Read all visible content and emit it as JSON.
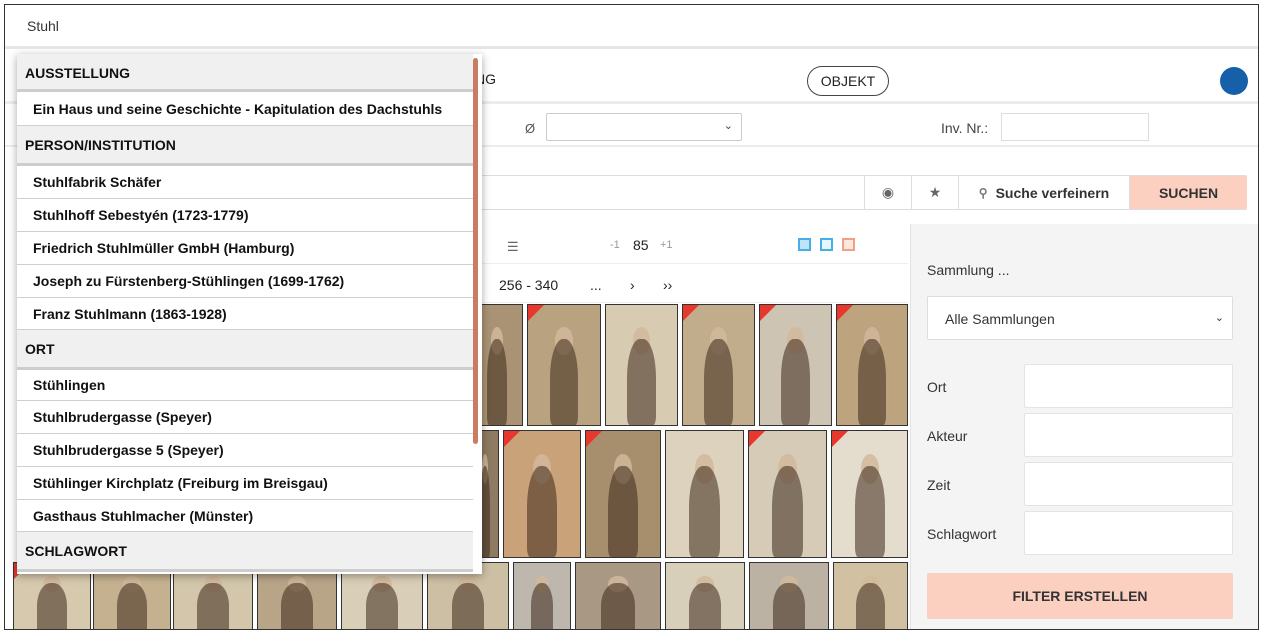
{
  "search": {
    "query": "Stuhl"
  },
  "nav": {
    "tab_partial": "NG",
    "objekt": "OBJEKT"
  },
  "filters": {
    "diameter_symbol": "Ø",
    "inv_label": "Inv. Nr.:"
  },
  "search_actions": {
    "refine": "Suche verfeinern",
    "search": "SUCHEN"
  },
  "results": {
    "zoom_minus": "-1",
    "zoom": "85",
    "zoom_plus": "+1"
  },
  "pager": {
    "range": "256 - 340",
    "ellipsis": "...",
    "next": "›",
    "last": "››"
  },
  "right_panel": {
    "collection_label": "Sammlung ...",
    "collection_selected": "Alle Sammlungen",
    "fields": [
      "Ort",
      "Akteur",
      "Zeit",
      "Schlagwort"
    ],
    "button": "FILTER ERSTELLEN"
  },
  "dropdown": {
    "groups": [
      {
        "category": "AUSSTELLUNG",
        "items": [
          "Ein Haus und seine Geschichte - Kapitulation des Dachstuhls"
        ]
      },
      {
        "category": "PERSON/INSTITUTION",
        "items": [
          "Stuhlfabrik Schäfer",
          "Stuhlhoff Sebestyén (1723-1779)",
          "Friedrich Stuhlmüller GmbH (Hamburg)",
          "Joseph zu Fürstenberg-Stühlingen (1699-1762)",
          "Franz Stuhlmann (1863-1928)"
        ]
      },
      {
        "category": "ORT",
        "items": [
          "Stühlingen",
          "Stuhlbrudergasse (Speyer)",
          "Stuhlbrudergasse 5 (Speyer)",
          "Stühlinger Kirchplatz (Freiburg im Breisgau)",
          "Gasthaus Stuhlmacher (Münster)"
        ]
      },
      {
        "category": "SCHLAGWORT",
        "items": []
      }
    ]
  },
  "colors": {
    "accent": "#fbd0c1",
    "avatar": "#1560a8",
    "flag": "#e8382e"
  }
}
